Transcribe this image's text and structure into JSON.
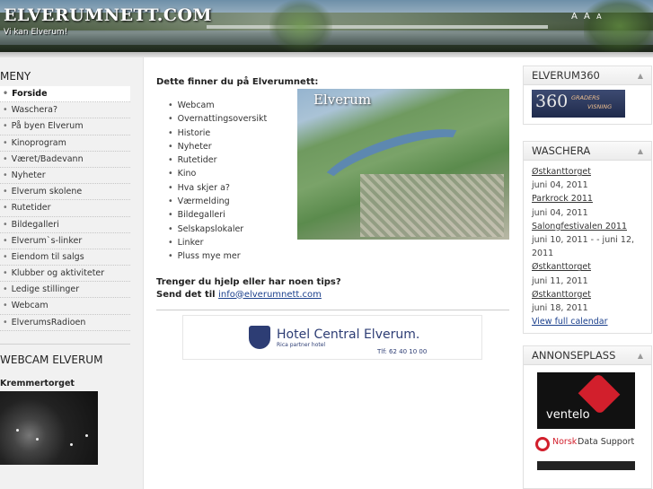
{
  "header": {
    "logo": "ELVERUMNETT.COM",
    "slogan": "Vi kan Elverum!",
    "font_sizer": [
      "A",
      "A",
      "A"
    ]
  },
  "left": {
    "menu_title": "MENY",
    "menu": [
      "Forside",
      "Waschera?",
      "På byen Elverum",
      "Kinoprogram",
      "Været/Badevann",
      "Nyheter",
      "Elverum skolene",
      "Rutetider",
      "Bildegalleri",
      "Elverum`s-linker",
      "Eiendom til salgs",
      "Klubber og aktiviteter",
      "Ledige stillinger",
      "Webcam",
      "ElverumsRadioen"
    ],
    "webcam_title": "WEBCAM ELVERUM",
    "webcam_caption": "Kremmertorget"
  },
  "main": {
    "heading": "Dette finner du på Elverumnett:",
    "features": [
      "Webcam",
      "Overnattingsoversikt",
      "Historie",
      "Nyheter",
      "Rutetider",
      "Kino",
      "Hva skjer a?",
      "Værmelding",
      "Bildegalleri",
      "Selskapslokaler",
      "Linker",
      "Pluss mye mer"
    ],
    "aerial_caption": "Elverum",
    "help_line1": "Trenger du hjelp eller har noen tips?",
    "help_line2": "Send det til",
    "help_email": "info@elverumnett.com",
    "hotel_name": "Hotel Central Elverum.",
    "hotel_sub": "Rica partner hotel",
    "hotel_tel": "Tlf: 62 40 10 00"
  },
  "right": {
    "box1_title": "ELVERUM360",
    "badge_num": "360",
    "badge_txt1": "GRADERS",
    "badge_txt2": "VISNING",
    "box2_title": "WASCHERA",
    "calendar": [
      {
        "event": "Østkanttorget",
        "date": "juni 04, 2011"
      },
      {
        "event": "Parkrock 2011",
        "date": "juni 04, 2011"
      },
      {
        "event": "Salongfestivalen 2011",
        "date": "juni 10, 2011 - - juni 12, 2011"
      },
      {
        "event": "Østkanttorget",
        "date": "juni 11, 2011"
      },
      {
        "event": "Østkanttorget",
        "date": "juni 18, 2011"
      }
    ],
    "calendar_link": "View full calendar",
    "box3_title": "ANNONSEPLASS",
    "ventelo_text": "ventelo",
    "norsk_t1": "Norsk",
    "norsk_t2": "Data Support"
  }
}
